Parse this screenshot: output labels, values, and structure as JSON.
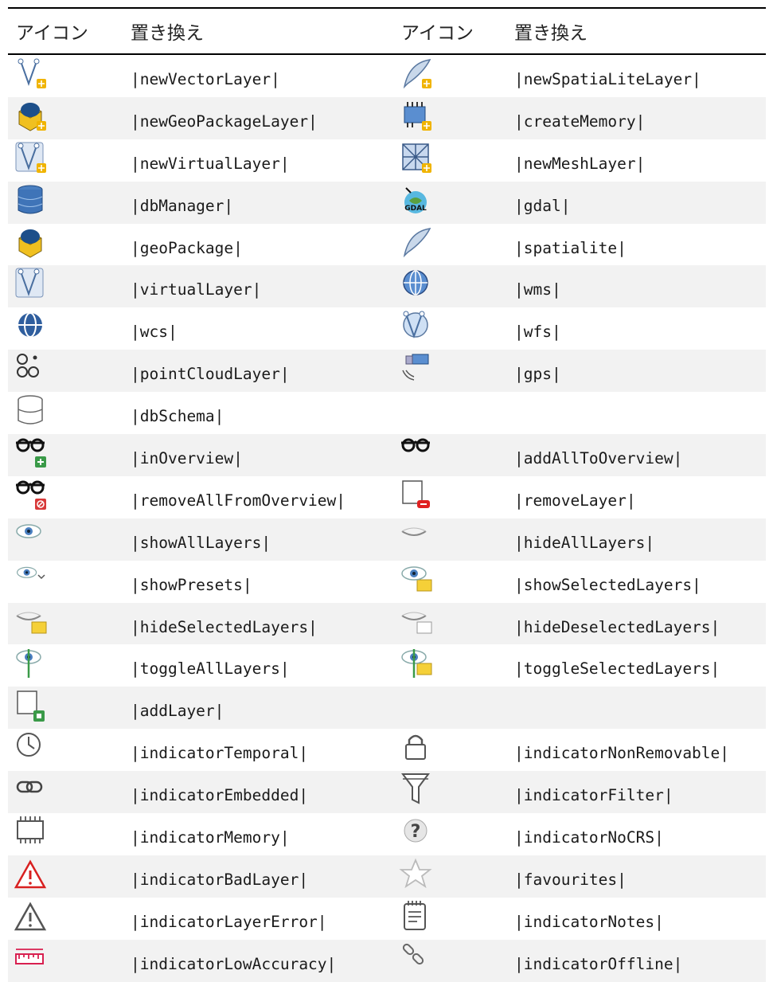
{
  "headers": {
    "icon_col_1": "アイコン",
    "replace_col_1": "置き換え",
    "icon_col_2": "アイコン",
    "replace_col_2": "置き換え"
  },
  "rows": [
    {
      "left_icon": "new-vector-layer-icon",
      "left_text": "|newVectorLayer|",
      "right_icon": "new-spatialite-layer-icon",
      "right_text": "|newSpatiaLiteLayer|"
    },
    {
      "left_icon": "new-geopackage-layer-icon",
      "left_text": "|newGeoPackageLayer|",
      "right_icon": "create-memory-icon",
      "right_text": "|createMemory|"
    },
    {
      "left_icon": "new-virtual-layer-icon",
      "left_text": "|newVirtualLayer|",
      "right_icon": "new-mesh-layer-icon",
      "right_text": "|newMeshLayer|"
    },
    {
      "left_icon": "db-manager-icon",
      "left_text": "|dbManager|",
      "right_icon": "gdal-icon",
      "right_text": "|gdal|"
    },
    {
      "left_icon": "geopackage-icon",
      "left_text": "|geoPackage|",
      "right_icon": "spatialite-icon",
      "right_text": "|spatialite|"
    },
    {
      "left_icon": "virtual-layer-icon",
      "left_text": "|virtualLayer|",
      "right_icon": "wms-icon",
      "right_text": "|wms|"
    },
    {
      "left_icon": "wcs-icon",
      "left_text": "|wcs|",
      "right_icon": "wfs-icon",
      "right_text": "|wfs|"
    },
    {
      "left_icon": "point-cloud-layer-icon",
      "left_text": "|pointCloudLayer|",
      "right_icon": "gps-icon",
      "right_text": "|gps|"
    },
    {
      "left_icon": "db-schema-icon",
      "left_text": "|dbSchema|",
      "right_icon": "",
      "right_text": ""
    },
    {
      "left_icon": "in-overview-icon",
      "left_text": "|inOverview|",
      "right_icon": "add-all-to-overview-icon",
      "right_text": "|addAllToOverview|"
    },
    {
      "left_icon": "remove-all-from-overview-icon",
      "left_text": "|removeAllFromOverview|",
      "right_icon": "remove-layer-icon",
      "right_text": "|removeLayer|"
    },
    {
      "left_icon": "show-all-layers-icon",
      "left_text": "|showAllLayers|",
      "right_icon": "hide-all-layers-icon",
      "right_text": "|hideAllLayers|"
    },
    {
      "left_icon": "show-presets-icon",
      "left_text": "|showPresets|",
      "right_icon": "show-selected-layers-icon",
      "right_text": "|showSelectedLayers|"
    },
    {
      "left_icon": "hide-selected-layers-icon",
      "left_text": "|hideSelectedLayers|",
      "right_icon": "hide-deselected-layers-icon",
      "right_text": "|hideDeselectedLayers|"
    },
    {
      "left_icon": "toggle-all-layers-icon",
      "left_text": "|toggleAllLayers|",
      "right_icon": "toggle-selected-layers-icon",
      "right_text": "|toggleSelectedLayers|"
    },
    {
      "left_icon": "add-layer-icon",
      "left_text": "|addLayer|",
      "right_icon": "",
      "right_text": ""
    },
    {
      "left_icon": "indicator-temporal-icon",
      "left_text": "|indicatorTemporal|",
      "right_icon": "indicator-non-removable-icon",
      "right_text": "|indicatorNonRemovable|"
    },
    {
      "left_icon": "indicator-embedded-icon",
      "left_text": "|indicatorEmbedded|",
      "right_icon": "indicator-filter-icon",
      "right_text": "|indicatorFilter|"
    },
    {
      "left_icon": "indicator-memory-icon",
      "left_text": "|indicatorMemory|",
      "right_icon": "indicator-no-crs-icon",
      "right_text": "|indicatorNoCRS|"
    },
    {
      "left_icon": "indicator-bad-layer-icon",
      "left_text": "|indicatorBadLayer|",
      "right_icon": "favourites-icon",
      "right_text": "|favourites|"
    },
    {
      "left_icon": "indicator-layer-error-icon",
      "left_text": "|indicatorLayerError|",
      "right_icon": "indicator-notes-icon",
      "right_text": "|indicatorNotes|"
    },
    {
      "left_icon": "indicator-low-accuracy-icon",
      "left_text": "|indicatorLowAccuracy|",
      "right_icon": "indicator-offline-icon",
      "right_text": "|indicatorOffline|"
    }
  ]
}
